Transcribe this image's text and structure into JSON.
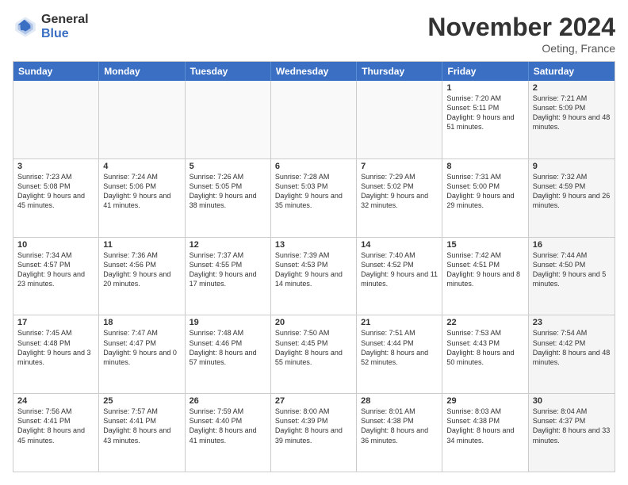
{
  "logo": {
    "line1": "General",
    "line2": "Blue"
  },
  "title": "November 2024",
  "location": "Oeting, France",
  "header_days": [
    "Sunday",
    "Monday",
    "Tuesday",
    "Wednesday",
    "Thursday",
    "Friday",
    "Saturday"
  ],
  "rows": [
    [
      {
        "day": "",
        "text": "",
        "empty": true
      },
      {
        "day": "",
        "text": "",
        "empty": true
      },
      {
        "day": "",
        "text": "",
        "empty": true
      },
      {
        "day": "",
        "text": "",
        "empty": true
      },
      {
        "day": "",
        "text": "",
        "empty": true
      },
      {
        "day": "1",
        "text": "Sunrise: 7:20 AM\nSunset: 5:11 PM\nDaylight: 9 hours and 51 minutes.",
        "empty": false,
        "shaded": false
      },
      {
        "day": "2",
        "text": "Sunrise: 7:21 AM\nSunset: 5:09 PM\nDaylight: 9 hours and 48 minutes.",
        "empty": false,
        "shaded": true
      }
    ],
    [
      {
        "day": "3",
        "text": "Sunrise: 7:23 AM\nSunset: 5:08 PM\nDaylight: 9 hours and 45 minutes.",
        "empty": false,
        "shaded": false
      },
      {
        "day": "4",
        "text": "Sunrise: 7:24 AM\nSunset: 5:06 PM\nDaylight: 9 hours and 41 minutes.",
        "empty": false,
        "shaded": false
      },
      {
        "day": "5",
        "text": "Sunrise: 7:26 AM\nSunset: 5:05 PM\nDaylight: 9 hours and 38 minutes.",
        "empty": false,
        "shaded": false
      },
      {
        "day": "6",
        "text": "Sunrise: 7:28 AM\nSunset: 5:03 PM\nDaylight: 9 hours and 35 minutes.",
        "empty": false,
        "shaded": false
      },
      {
        "day": "7",
        "text": "Sunrise: 7:29 AM\nSunset: 5:02 PM\nDaylight: 9 hours and 32 minutes.",
        "empty": false,
        "shaded": false
      },
      {
        "day": "8",
        "text": "Sunrise: 7:31 AM\nSunset: 5:00 PM\nDaylight: 9 hours and 29 minutes.",
        "empty": false,
        "shaded": false
      },
      {
        "day": "9",
        "text": "Sunrise: 7:32 AM\nSunset: 4:59 PM\nDaylight: 9 hours and 26 minutes.",
        "empty": false,
        "shaded": true
      }
    ],
    [
      {
        "day": "10",
        "text": "Sunrise: 7:34 AM\nSunset: 4:57 PM\nDaylight: 9 hours and 23 minutes.",
        "empty": false,
        "shaded": false
      },
      {
        "day": "11",
        "text": "Sunrise: 7:36 AM\nSunset: 4:56 PM\nDaylight: 9 hours and 20 minutes.",
        "empty": false,
        "shaded": false
      },
      {
        "day": "12",
        "text": "Sunrise: 7:37 AM\nSunset: 4:55 PM\nDaylight: 9 hours and 17 minutes.",
        "empty": false,
        "shaded": false
      },
      {
        "day": "13",
        "text": "Sunrise: 7:39 AM\nSunset: 4:53 PM\nDaylight: 9 hours and 14 minutes.",
        "empty": false,
        "shaded": false
      },
      {
        "day": "14",
        "text": "Sunrise: 7:40 AM\nSunset: 4:52 PM\nDaylight: 9 hours and 11 minutes.",
        "empty": false,
        "shaded": false
      },
      {
        "day": "15",
        "text": "Sunrise: 7:42 AM\nSunset: 4:51 PM\nDaylight: 9 hours and 8 minutes.",
        "empty": false,
        "shaded": false
      },
      {
        "day": "16",
        "text": "Sunrise: 7:44 AM\nSunset: 4:50 PM\nDaylight: 9 hours and 5 minutes.",
        "empty": false,
        "shaded": true
      }
    ],
    [
      {
        "day": "17",
        "text": "Sunrise: 7:45 AM\nSunset: 4:48 PM\nDaylight: 9 hours and 3 minutes.",
        "empty": false,
        "shaded": false
      },
      {
        "day": "18",
        "text": "Sunrise: 7:47 AM\nSunset: 4:47 PM\nDaylight: 9 hours and 0 minutes.",
        "empty": false,
        "shaded": false
      },
      {
        "day": "19",
        "text": "Sunrise: 7:48 AM\nSunset: 4:46 PM\nDaylight: 8 hours and 57 minutes.",
        "empty": false,
        "shaded": false
      },
      {
        "day": "20",
        "text": "Sunrise: 7:50 AM\nSunset: 4:45 PM\nDaylight: 8 hours and 55 minutes.",
        "empty": false,
        "shaded": false
      },
      {
        "day": "21",
        "text": "Sunrise: 7:51 AM\nSunset: 4:44 PM\nDaylight: 8 hours and 52 minutes.",
        "empty": false,
        "shaded": false
      },
      {
        "day": "22",
        "text": "Sunrise: 7:53 AM\nSunset: 4:43 PM\nDaylight: 8 hours and 50 minutes.",
        "empty": false,
        "shaded": false
      },
      {
        "day": "23",
        "text": "Sunrise: 7:54 AM\nSunset: 4:42 PM\nDaylight: 8 hours and 48 minutes.",
        "empty": false,
        "shaded": true
      }
    ],
    [
      {
        "day": "24",
        "text": "Sunrise: 7:56 AM\nSunset: 4:41 PM\nDaylight: 8 hours and 45 minutes.",
        "empty": false,
        "shaded": false
      },
      {
        "day": "25",
        "text": "Sunrise: 7:57 AM\nSunset: 4:41 PM\nDaylight: 8 hours and 43 minutes.",
        "empty": false,
        "shaded": false
      },
      {
        "day": "26",
        "text": "Sunrise: 7:59 AM\nSunset: 4:40 PM\nDaylight: 8 hours and 41 minutes.",
        "empty": false,
        "shaded": false
      },
      {
        "day": "27",
        "text": "Sunrise: 8:00 AM\nSunset: 4:39 PM\nDaylight: 8 hours and 39 minutes.",
        "empty": false,
        "shaded": false
      },
      {
        "day": "28",
        "text": "Sunrise: 8:01 AM\nSunset: 4:38 PM\nDaylight: 8 hours and 36 minutes.",
        "empty": false,
        "shaded": false
      },
      {
        "day": "29",
        "text": "Sunrise: 8:03 AM\nSunset: 4:38 PM\nDaylight: 8 hours and 34 minutes.",
        "empty": false,
        "shaded": false
      },
      {
        "day": "30",
        "text": "Sunrise: 8:04 AM\nSunset: 4:37 PM\nDaylight: 8 hours and 33 minutes.",
        "empty": false,
        "shaded": true
      }
    ]
  ]
}
